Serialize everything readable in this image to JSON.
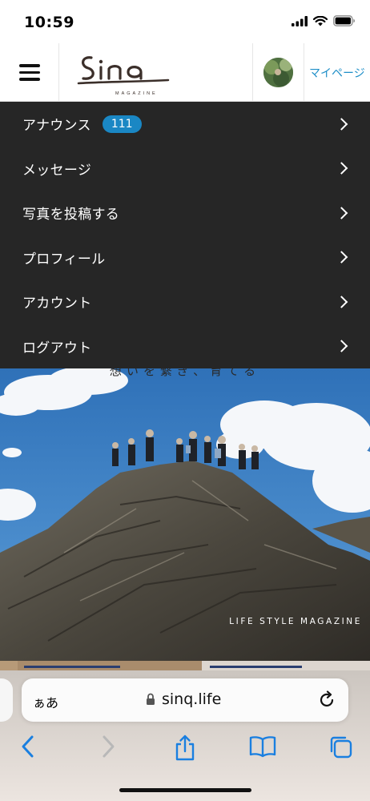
{
  "status_bar": {
    "time": "10:59"
  },
  "header": {
    "logo_text": "Sinq",
    "logo_subtext": "MAGAZINE",
    "mypage_label": "マイページ"
  },
  "menu": {
    "items": [
      {
        "label": "アナウンス",
        "badge": "111"
      },
      {
        "label": "メッセージ"
      },
      {
        "label": "写真を投稿する"
      },
      {
        "label": "プロフィール"
      },
      {
        "label": "アカウント"
      },
      {
        "label": "ログアウト"
      }
    ]
  },
  "hero": {
    "tagline": "想いを繋ぎ、育てる",
    "caption": "LIFE STYLE MAGAZINE"
  },
  "browser": {
    "aa_label": "ぁあ",
    "url": "sinq.life"
  },
  "colors": {
    "accent": "#1f8fc8",
    "badge": "#1a87c4",
    "menu_bg": "#262626",
    "toolbar_icon": "#1a7fe0"
  }
}
